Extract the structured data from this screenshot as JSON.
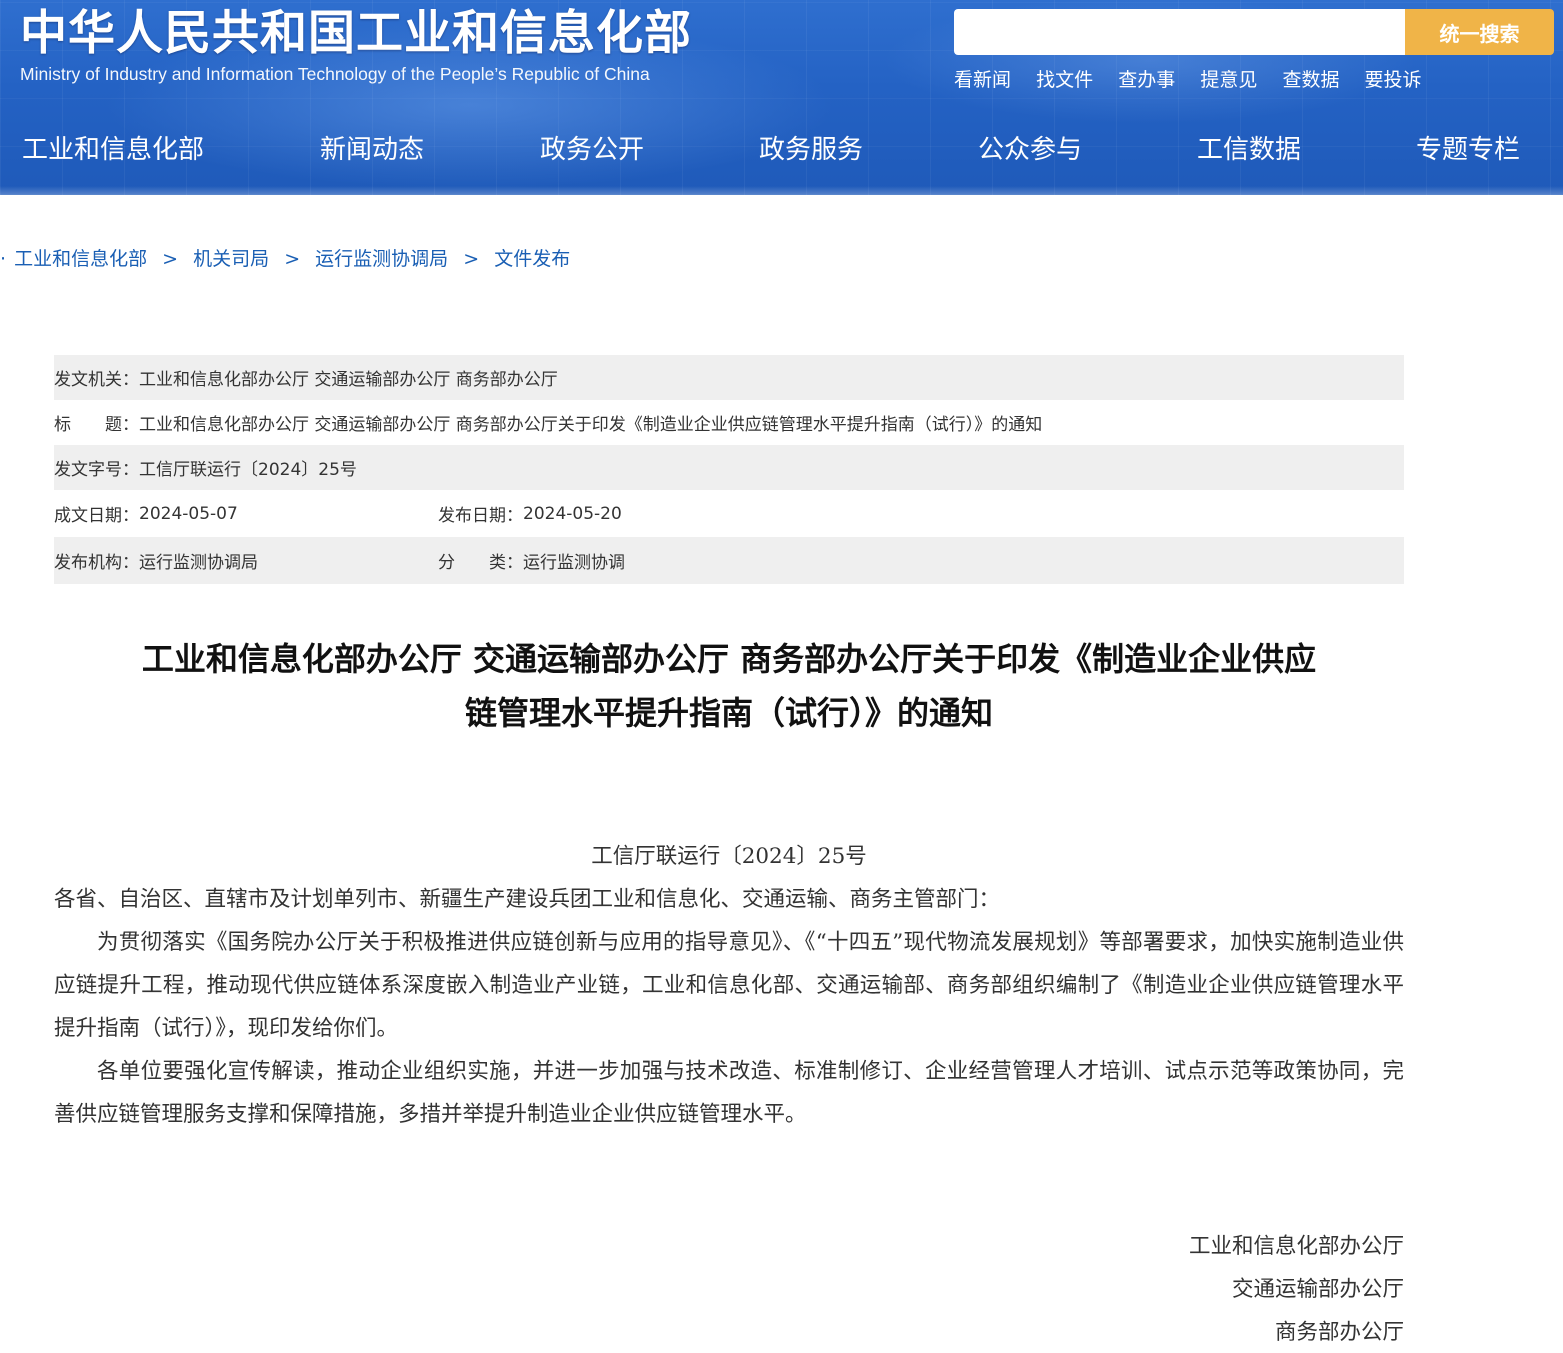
{
  "header": {
    "logo_cn": "中华人民共和国工业和信息化部",
    "logo_en": "Ministry of Industry and Information Technology of the People’s Republic of China",
    "search": {
      "value": "",
      "placeholder": "",
      "button_label": "统一搜索"
    },
    "quick_links": [
      "看新闻",
      "找文件",
      "查办事",
      "提意见",
      "查数据",
      "要投诉"
    ],
    "nav": [
      "工业和信息化部",
      "新闻动态",
      "政务公开",
      "政务服务",
      "公众参与",
      "工信数据",
      "专题专栏"
    ]
  },
  "breadcrumb": {
    "lead": "·",
    "items": [
      "工业和信息化部",
      "机关司局",
      "运行监测协调局",
      "文件发布"
    ],
    "separator": ">"
  },
  "meta": {
    "issuer_label": "发文机关：",
    "issuer": "工业和信息化部办公厅 交通运输部办公厅 商务部办公厅",
    "title_label": "标　　题：",
    "title": "工业和信息化部办公厅 交通运输部办公厅 商务部办公厅关于印发《制造业企业供应链管理水平提升指南（试行）》的通知",
    "doc_no_label": "发文字号：",
    "doc_no": "工信厅联运行〔2024〕25号",
    "created_label": "成文日期：",
    "created": "2024-05-07",
    "published_label": "发布日期：",
    "published": "2024-05-20",
    "org_label": "发布机构：",
    "org": "运行监测协调局",
    "category_label": "分　　类：",
    "category": "运行监测协调"
  },
  "document": {
    "title_line1": "工业和信息化部办公厅 交通运输部办公厅 商务部办公厅关于印发《制造业企业供应",
    "title_line2": "链管理水平提升指南（试行）》的通知",
    "doc_number": "工信厅联运行〔2024〕25号",
    "salutation": "各省、自治区、直辖市及计划单列市、新疆生产建设兵团工业和信息化、交通运输、商务主管部门：",
    "paragraph1": "为贯彻落实《国务院办公厅关于积极推进供应链创新与应用的指导意见》、《“十四五”现代物流发展规划》等部署要求，加快实施制造业供应链提升工程，推动现代供应链体系深度嵌入制造业产业链，工业和信息化部、交通运输部、商务部组织编制了《制造业企业供应链管理水平提升指南（试行）》，现印发给你们。",
    "paragraph2": "各单位要强化宣传解读，推动企业组织实施，并进一步加强与技术改造、标准制修订、企业经营管理人才培训、试点示范等政策协同，完善供应链管理服务支撑和保障措施，多措并举提升制造业企业供应链管理水平。",
    "signatures": [
      "工业和信息化部办公厅",
      "交通运输部办公厅",
      "商务部办公厅"
    ]
  },
  "colors": {
    "header_blue": "#2462c4",
    "search_button": "#f0b448",
    "link_blue": "#1a5fb4",
    "meta_row_gray": "#efefef"
  }
}
